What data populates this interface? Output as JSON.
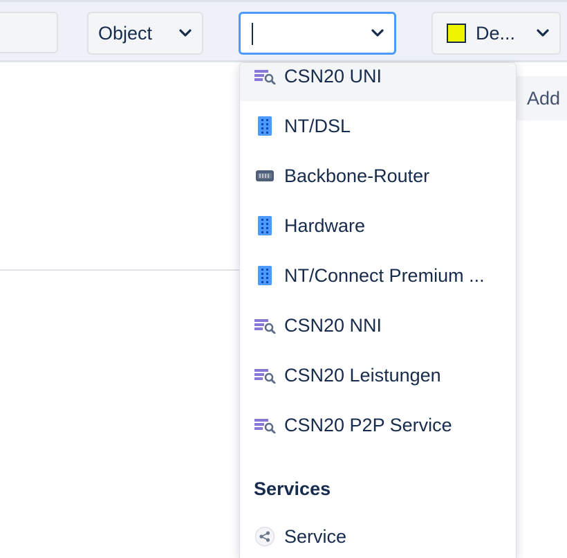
{
  "toolbar": {
    "object_select": {
      "label": "Object"
    },
    "search_select": {
      "value": ""
    },
    "color_select": {
      "label": "De...",
      "swatch_color": "#eef500"
    }
  },
  "side_button": {
    "label": "Add"
  },
  "dropdown": {
    "options": [
      {
        "label": "CSN20 UNI",
        "icon": "list-search-icon"
      },
      {
        "label": "NT/DSL",
        "icon": "server-rack-icon"
      },
      {
        "label": "Backbone-Router",
        "icon": "router-icon"
      },
      {
        "label": "Hardware",
        "icon": "server-rack-icon"
      },
      {
        "label": "NT/Connect Premium ...",
        "icon": "server-rack-icon"
      },
      {
        "label": "CSN20 NNI",
        "icon": "list-search-icon"
      },
      {
        "label": "CSN20 Leistungen",
        "icon": "list-search-icon"
      },
      {
        "label": "CSN20 P2P Service",
        "icon": "list-search-icon"
      }
    ],
    "groups": [
      {
        "heading": "Services",
        "options": [
          {
            "label": "Service",
            "icon": "share-icon"
          }
        ]
      }
    ]
  }
}
